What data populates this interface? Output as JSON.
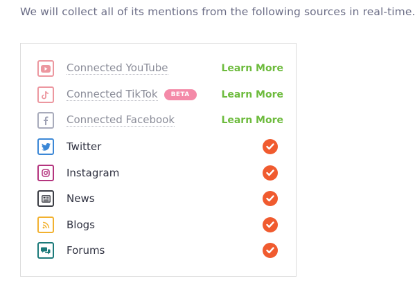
{
  "intro_text": "We will collect all of its mentions from the following sources in real-time.",
  "sources": [
    {
      "label": "Connected YouTube",
      "icon": "youtube-icon",
      "color": "#e9858f",
      "status": "learn_more",
      "action": "Learn More"
    },
    {
      "label": "Connected TikTok",
      "icon": "tiktok-icon",
      "color": "#e9858f",
      "status": "learn_more",
      "action": "Learn More",
      "badge": "BETA"
    },
    {
      "label": "Connected Facebook",
      "icon": "facebook-icon",
      "color": "#8e91a7",
      "status": "learn_more",
      "action": "Learn More"
    },
    {
      "label": "Twitter",
      "icon": "twitter-icon",
      "color": "#3b87d6",
      "status": "enabled"
    },
    {
      "label": "Instagram",
      "icon": "instagram-icon",
      "color": "#b4347e",
      "status": "enabled"
    },
    {
      "label": "News",
      "icon": "news-icon",
      "color": "#3b3d44",
      "status": "enabled"
    },
    {
      "label": "Blogs",
      "icon": "blog-rss-icon",
      "color": "#f2b12f",
      "status": "enabled"
    },
    {
      "label": "Forums",
      "icon": "forums-icon",
      "color": "#1b7a7a",
      "status": "enabled"
    }
  ],
  "colors": {
    "learn_more": "#6dbb3d",
    "check": "#f05b2f",
    "beta_badge": "#f48aa8"
  }
}
